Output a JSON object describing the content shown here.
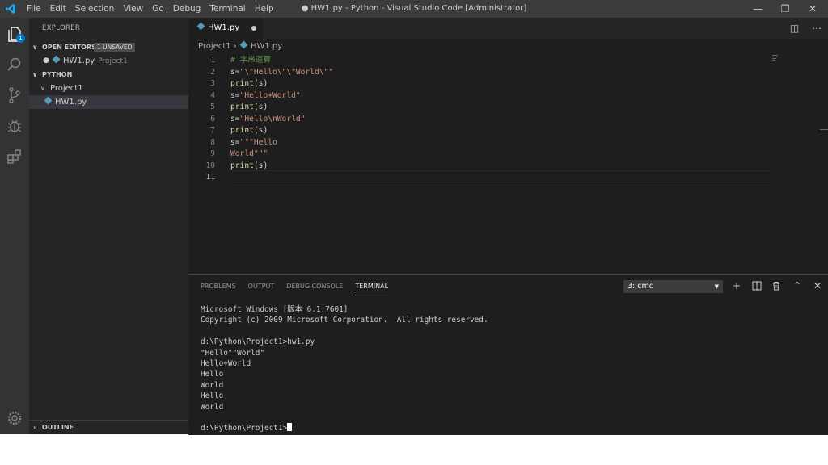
{
  "window": {
    "title": "● HW1.py - Python - Visual Studio Code [Administrator]",
    "menu": [
      "File",
      "Edit",
      "Selection",
      "View",
      "Go",
      "Debug",
      "Terminal",
      "Help"
    ]
  },
  "activity": {
    "badge_count": "1"
  },
  "sidebar": {
    "title": "EXPLORER",
    "open_editors": {
      "label": "OPEN EDITORS",
      "badge": "1 UNSAVED",
      "files": [
        {
          "name": "HW1.py",
          "folder": "Project1"
        }
      ]
    },
    "workspace": {
      "label": "PYTHON",
      "folder": "Project1",
      "files": [
        "HW1.py"
      ]
    },
    "outline_label": "OUTLINE"
  },
  "editor": {
    "tab_label": "HW1.py",
    "breadcrumb": [
      "Project1",
      "HW1.py"
    ],
    "line_numbers": [
      "1",
      "2",
      "3",
      "4",
      "5",
      "6",
      "7",
      "8",
      "9",
      "10",
      "11"
    ],
    "lines": [
      {
        "segments": [
          {
            "cls": "cmt",
            "t": "# 字串運算"
          }
        ]
      },
      {
        "segments": [
          {
            "cls": "",
            "t": "s="
          },
          {
            "cls": "str",
            "t": "\"\\\"Hello\\\"\\\"World\\\"\""
          }
        ]
      },
      {
        "segments": [
          {
            "cls": "fn",
            "t": "print"
          },
          {
            "cls": "",
            "t": "(s)"
          }
        ]
      },
      {
        "segments": [
          {
            "cls": "",
            "t": "s="
          },
          {
            "cls": "str",
            "t": "\"Hello+World\""
          }
        ]
      },
      {
        "segments": [
          {
            "cls": "fn",
            "t": "print"
          },
          {
            "cls": "",
            "t": "(s)"
          }
        ]
      },
      {
        "segments": [
          {
            "cls": "",
            "t": "s="
          },
          {
            "cls": "str",
            "t": "\"Hello\\nWorld\""
          }
        ]
      },
      {
        "segments": [
          {
            "cls": "fn",
            "t": "print"
          },
          {
            "cls": "",
            "t": "(s)"
          }
        ]
      },
      {
        "segments": [
          {
            "cls": "",
            "t": "s="
          },
          {
            "cls": "str",
            "t": "\"\"\"Hello"
          }
        ]
      },
      {
        "segments": [
          {
            "cls": "str",
            "t": "World\"\"\""
          }
        ]
      },
      {
        "segments": [
          {
            "cls": "fn",
            "t": "print"
          },
          {
            "cls": "",
            "t": "(s)"
          }
        ]
      },
      {
        "segments": []
      }
    ]
  },
  "panel": {
    "tabs": [
      "PROBLEMS",
      "OUTPUT",
      "DEBUG CONSOLE",
      "TERMINAL"
    ],
    "active_tab": "TERMINAL",
    "terminal_select": "3: cmd",
    "terminal_lines": [
      "Microsoft Windows [版本 6.1.7601]",
      "Copyright (c) 2009 Microsoft Corporation.  All rights reserved.",
      "",
      "d:\\Python\\Project1>hw1.py",
      "\"Hello\"\"World\"",
      "Hello+World",
      "Hello",
      "World",
      "Hello",
      "World",
      ""
    ],
    "prompt": "d:\\Python\\Project1>"
  },
  "colors": {
    "accent": "#007acc",
    "python_icon": "#519aba",
    "string": "#ce9178",
    "comment": "#6a9955",
    "function": "#dcdcaa"
  }
}
